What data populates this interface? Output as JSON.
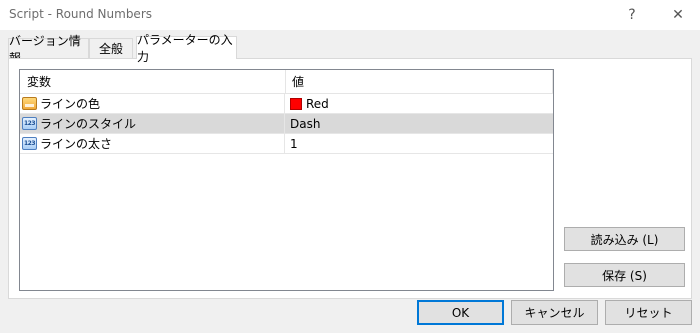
{
  "window": {
    "title": "Script - Round Numbers",
    "help_label": "?",
    "close_label": "✕"
  },
  "tabs": [
    {
      "label": "バージョン情報",
      "active": false
    },
    {
      "label": "全般",
      "active": false
    },
    {
      "label": "パラメーターの入力",
      "active": true
    }
  ],
  "grid": {
    "columns": [
      "変数",
      "値"
    ],
    "rows": [
      {
        "icon": "color-icon",
        "name": "ラインの色",
        "value": "Red",
        "swatch_color": "#ff0000",
        "selected": false
      },
      {
        "icon": "numeric-icon",
        "name": "ラインのスタイル",
        "value": "Dash",
        "selected": true
      },
      {
        "icon": "numeric-icon",
        "name": "ラインの太さ",
        "value": "1",
        "selected": false
      }
    ],
    "numeric_icon_text": "123"
  },
  "side_buttons": {
    "load": "読み込み (L)",
    "save": "保存 (S)"
  },
  "bottom_buttons": {
    "ok": "OK",
    "cancel": "キャンセル",
    "reset": "リセット"
  },
  "colors": {
    "accent": "#0078d7",
    "selected_row": "#d9d9d9",
    "swatch_red": "#ff0000"
  }
}
